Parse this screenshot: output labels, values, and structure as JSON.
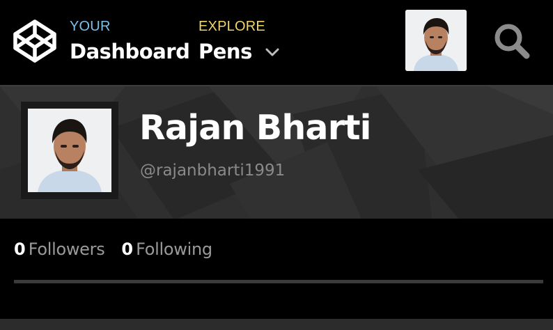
{
  "nav": {
    "logo_icon": "codepen-logo-icon",
    "your": {
      "kicker": "YOUR",
      "title": "Dashboard"
    },
    "explore": {
      "kicker": "EXPLORE",
      "title": "Pens"
    },
    "dropdown_icon": "chevron-down-icon",
    "search_icon": "search-icon",
    "colors": {
      "your": "#79c0ec",
      "explore": "#f0d66b"
    }
  },
  "profile": {
    "name": "Rajan Bharti",
    "handle": "@rajanbharti1991"
  },
  "stats": {
    "followers": {
      "count": "0",
      "label": "Followers"
    },
    "following": {
      "count": "0",
      "label": "Following"
    }
  }
}
